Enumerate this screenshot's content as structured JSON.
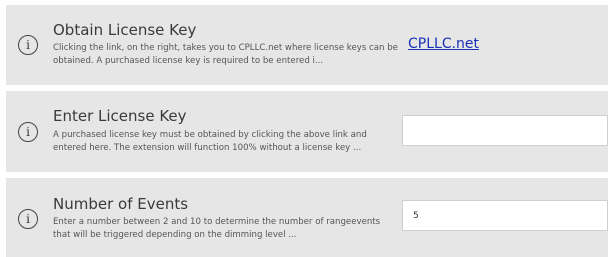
{
  "settings": [
    {
      "title": "Obtain License Key",
      "description": "Clicking the link, on the right, takes you to CPLLC.net where license keys can be obtained.  A purchased license key is required to be entered i...",
      "link_text": "CPLLC.net"
    },
    {
      "title": "Enter License Key",
      "description": "A purchased license key must be obtained by clicking the above link and entered here. The extension will function 100% without a license key ...",
      "value": ""
    },
    {
      "title": "Number of Events",
      "description": "Enter a number between 2 and 10 to determine the number of rangeevents that will be triggered depending  on the dimming level ...",
      "value": "5"
    }
  ],
  "icons": {
    "info": "info-circle-icon"
  }
}
